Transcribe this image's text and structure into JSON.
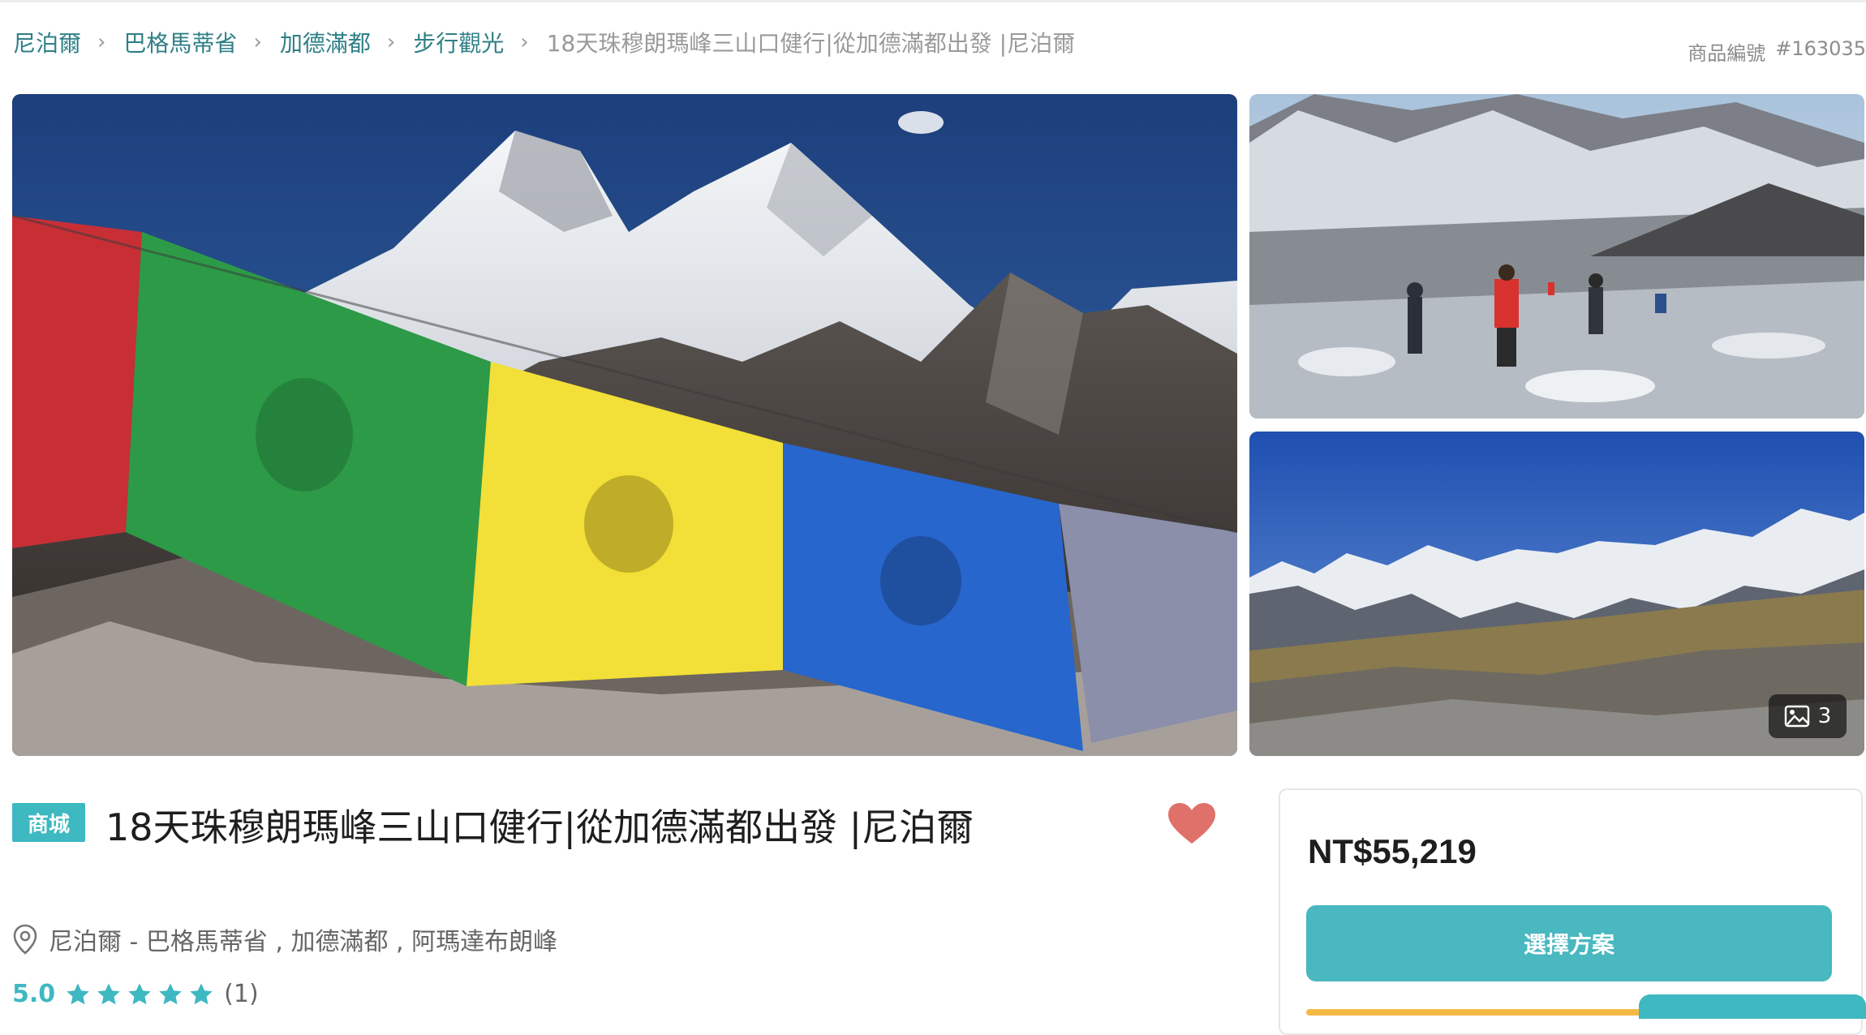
{
  "breadcrumb": {
    "items": [
      "尼泊爾",
      "巴格馬蒂省",
      "加德滿都",
      "步行觀光"
    ],
    "current": "18天珠穆朗瑪峰三山口健行|從加德滿都出發 |尼泊爾",
    "separator": "›"
  },
  "product_code": {
    "label": "商品編號",
    "value": "#163035"
  },
  "gallery": {
    "photo_count": "3"
  },
  "product": {
    "badge": "商城",
    "title": "18天珠穆朗瑪峰三山口健行|從加德滿都出發 |尼泊爾",
    "location": "尼泊爾 - 巴格馬蒂省 , 加德滿都 , 阿瑪達布朗峰",
    "rating_score": "5.0",
    "stars": 5,
    "review_count": "(1)"
  },
  "booking": {
    "price": "NT$55,219",
    "select_button": "選擇方案"
  },
  "colors": {
    "link": "#2f7f86",
    "accent": "#3eb8c1",
    "button": "#49b8c0",
    "heart": "#e0706a",
    "yellow_bar": "#f3b944"
  },
  "icons": {
    "location": "map-pin-icon",
    "favorite": "heart-icon",
    "rating": "star-icon",
    "gallery": "image-icon"
  }
}
